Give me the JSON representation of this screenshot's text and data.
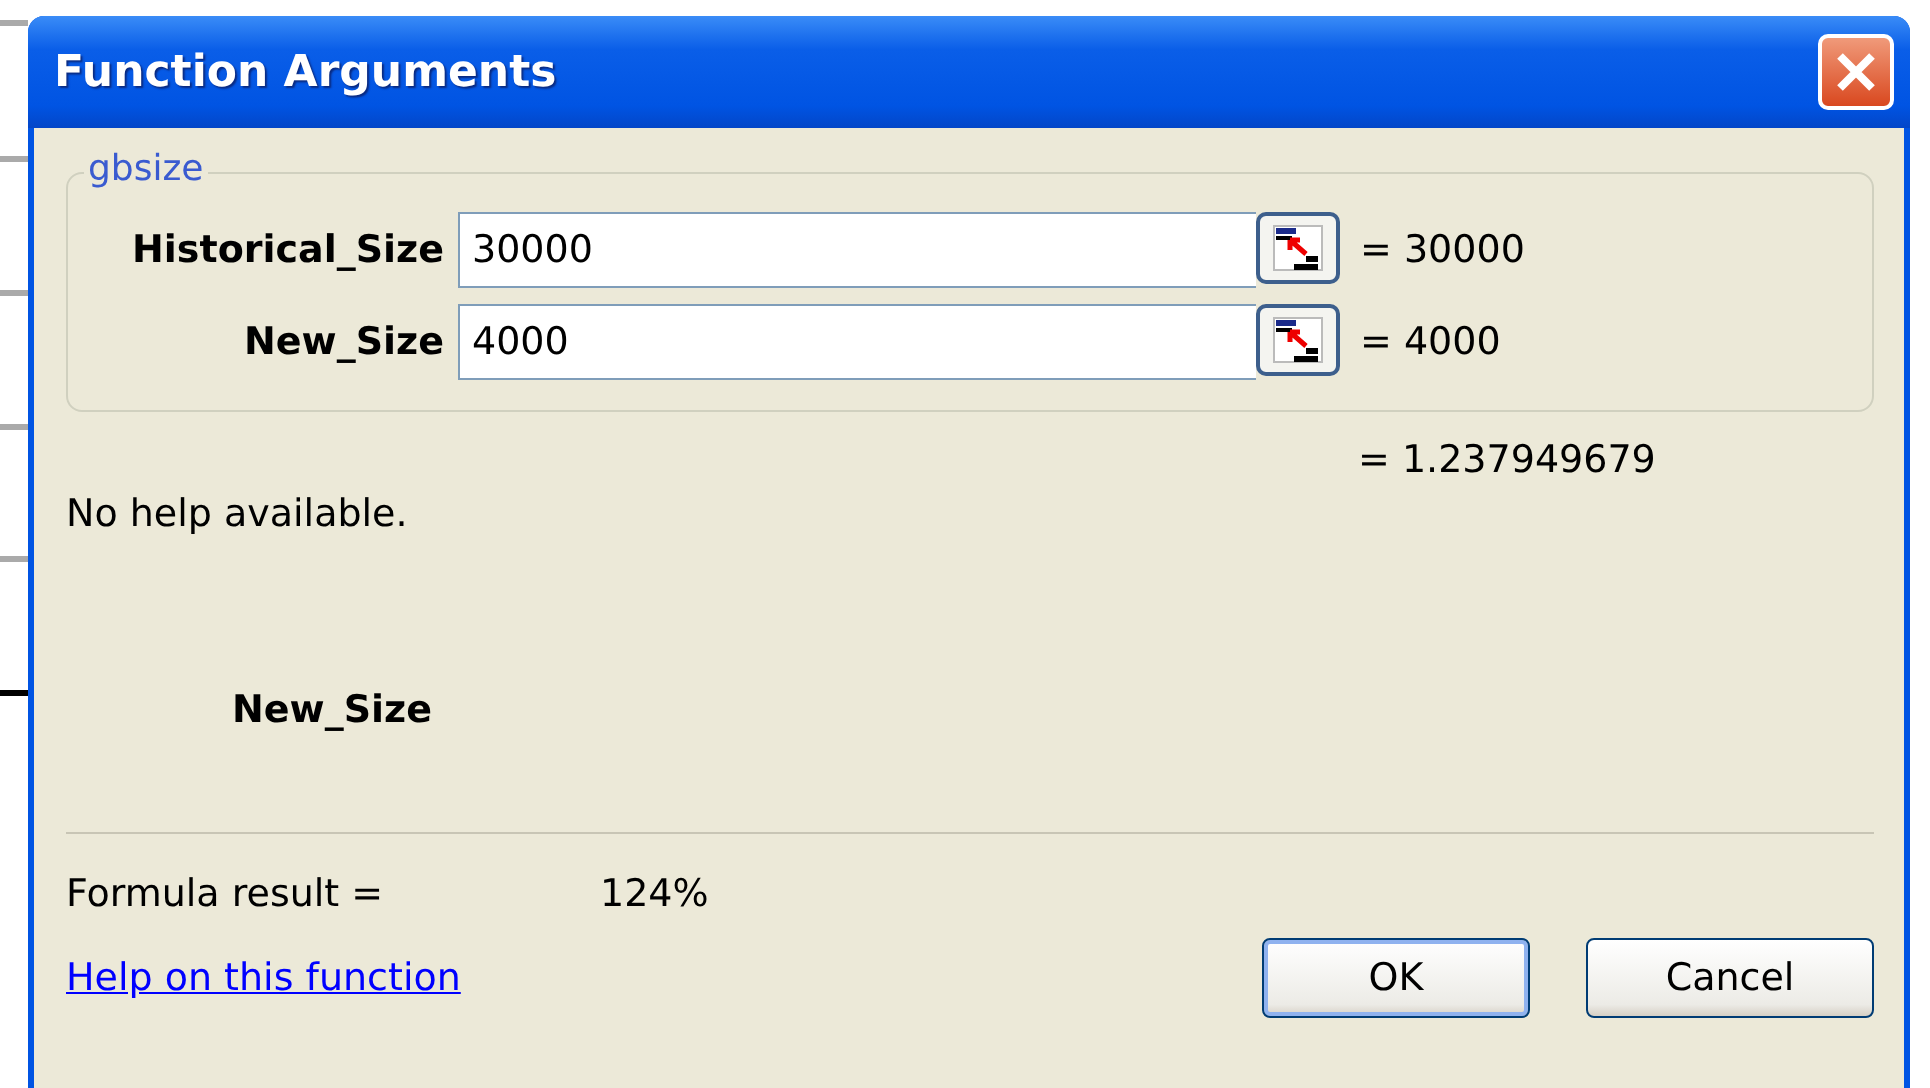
{
  "window": {
    "title": "Function Arguments"
  },
  "group": {
    "title": "gbsize",
    "arguments": [
      {
        "name": "Historical_Size",
        "value": "30000",
        "result": "= 30000"
      },
      {
        "name": "New_Size",
        "value": "4000",
        "result": "= 4000"
      }
    ]
  },
  "function_result": "= 1.237949679",
  "description": "No help available.",
  "argument_help": {
    "name": "New_Size"
  },
  "formula_result": {
    "label": "Formula result =",
    "value": "124%"
  },
  "help_link": "Help on this function",
  "buttons": [
    {
      "label": "OK",
      "default": true
    },
    {
      "label": "Cancel",
      "default": false
    }
  ]
}
